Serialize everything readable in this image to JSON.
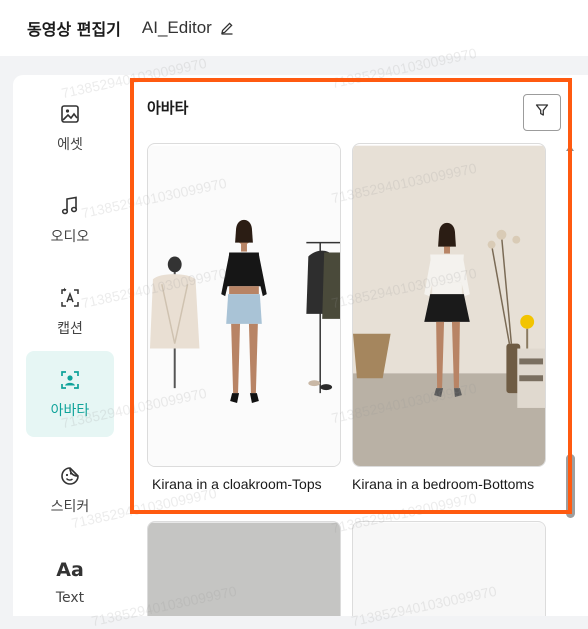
{
  "header": {
    "app_title": "동영상 편집기",
    "project_name": "AI_Editor"
  },
  "sidebar": {
    "items": [
      {
        "label": "에셋",
        "icon": "image-icon",
        "active": false
      },
      {
        "label": "오디오",
        "icon": "music-note-icon",
        "active": false
      },
      {
        "label": "캡션",
        "icon": "ai-caption-icon",
        "active": false
      },
      {
        "label": "아바타",
        "icon": "avatar-scan-icon",
        "active": true
      },
      {
        "label": "스티커",
        "icon": "sticker-smile-icon",
        "active": false
      },
      {
        "label": "Text",
        "icon": "text-aa-icon",
        "active": false
      }
    ]
  },
  "panel": {
    "title": "아바타",
    "cards": [
      {
        "label": "Kirana in a cloakroom-Tops"
      },
      {
        "label": "Kirana in a bedroom-Bottoms"
      },
      {
        "label": ""
      },
      {
        "label": ""
      }
    ]
  },
  "watermark": "7138529401030099970",
  "colors": {
    "accent": "#0fa39a",
    "accent_bg": "#e6f6f4",
    "highlight_border": "#ff5a10"
  }
}
